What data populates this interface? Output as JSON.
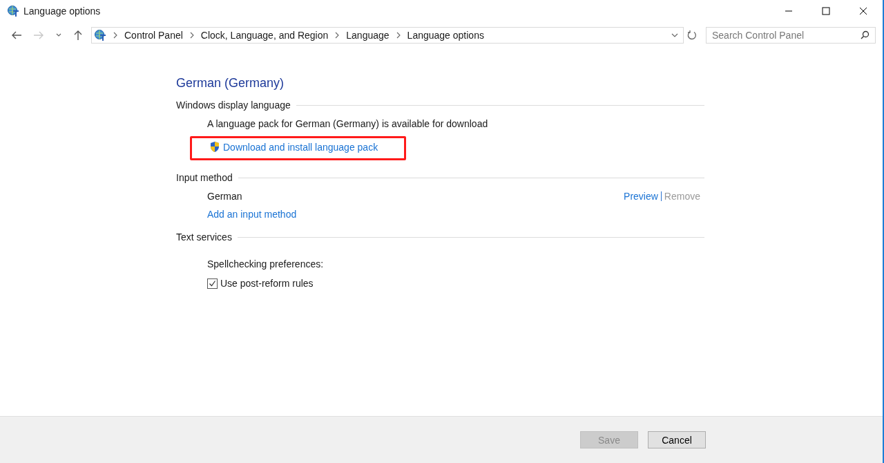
{
  "window": {
    "title": "Language options"
  },
  "navigation": {
    "back": {
      "disabled": false
    },
    "forward": {
      "disabled": true
    }
  },
  "address_bar": {
    "breadcrumbs": [
      "Control Panel",
      "Clock, Language, and Region",
      "Language",
      "Language options"
    ]
  },
  "search": {
    "placeholder": "Search Control Panel"
  },
  "heading": "German (Germany)",
  "sections": [
    {
      "kind": "download",
      "title": "Windows display language",
      "message": "A language pack for German (Germany) is available for download",
      "link": {
        "label": "Download and install language pack",
        "highlighted": true
      }
    },
    {
      "kind": "methods",
      "title": "Input method",
      "methods": [
        {
          "name": "German",
          "actions": [
            {
              "label": "Preview",
              "disabled": false
            },
            {
              "label": "Remove",
              "disabled": true
            }
          ]
        }
      ],
      "add_link": "Add an input method"
    },
    {
      "kind": "spelling",
      "title": "Text services",
      "label": "Spellchecking preferences:",
      "options": [
        {
          "label": "Use post-reform rules",
          "checked": true
        }
      ]
    }
  ],
  "buttons": [
    {
      "label": "Save",
      "disabled": true
    },
    {
      "label": "Cancel",
      "disabled": false
    }
  ]
}
